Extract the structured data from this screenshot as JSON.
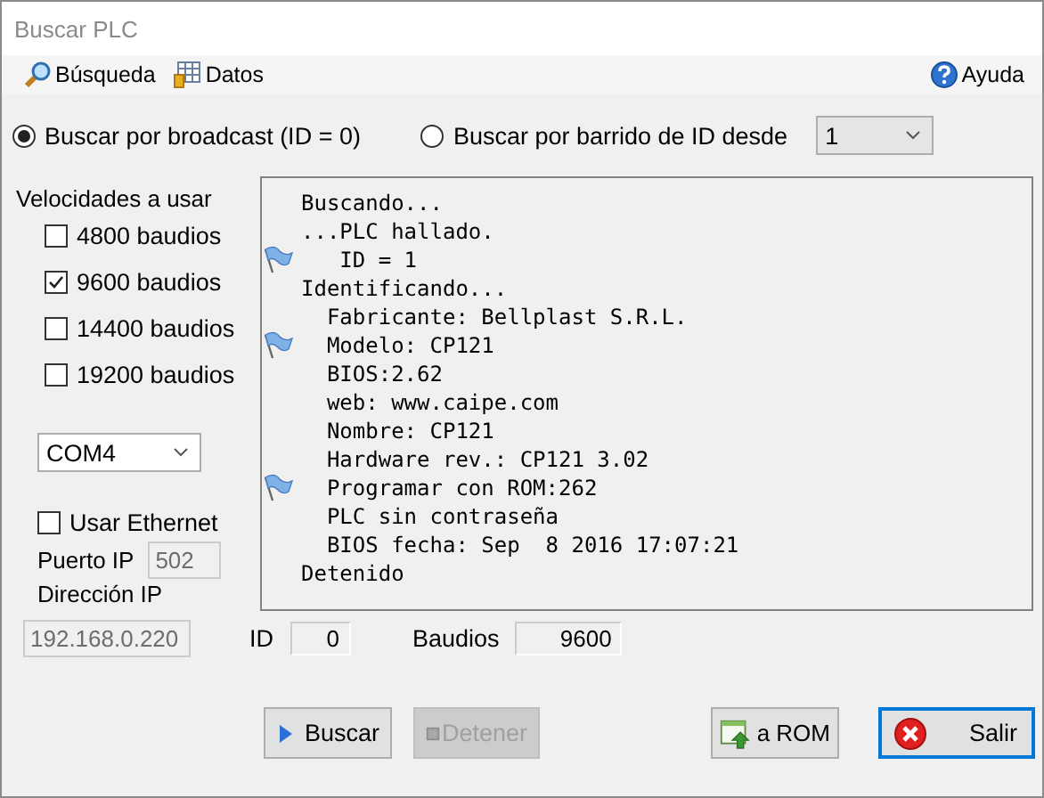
{
  "window": {
    "title": "Buscar PLC"
  },
  "menu": [
    {
      "label": "Búsqueda"
    },
    {
      "label": "Datos"
    }
  ],
  "help": {
    "label": "Ayuda"
  },
  "search_mode": [
    {
      "label": "Buscar por broadcast (ID = 0)",
      "selected": true
    },
    {
      "label": "Buscar por barrido de ID desde",
      "selected": false
    }
  ],
  "start_id": {
    "value": "1"
  },
  "speeds": {
    "title": "Velocidades a usar",
    "items": [
      {
        "label": "4800 baudios",
        "checked": false
      },
      {
        "label": "9600 baudios",
        "checked": true
      },
      {
        "label": "14400 baudios",
        "checked": false
      },
      {
        "label": "19200 baudios",
        "checked": false
      }
    ]
  },
  "port": {
    "value": "COM4"
  },
  "ethernet": {
    "label": "Usar Ethernet",
    "checked": false,
    "port_label": "Puerto IP",
    "port_value": "502",
    "address_label": "Dirección IP",
    "address_value": "192.168.0.220"
  },
  "log": [
    {
      "text": "Buscando...",
      "flag": false
    },
    {
      "text": "...PLC hallado.",
      "flag": false
    },
    {
      "text": "   ID = 1",
      "flag": true
    },
    {
      "text": "Identificando...",
      "flag": false
    },
    {
      "text": "  Fabricante: Bellplast S.R.L.",
      "flag": false
    },
    {
      "text": "  Modelo: CP121",
      "flag": true
    },
    {
      "text": "  BIOS:2.62",
      "flag": false
    },
    {
      "text": "  web: www.caipe.com",
      "flag": false
    },
    {
      "text": "  Nombre: CP121",
      "flag": false
    },
    {
      "text": "  Hardware rev.: CP121 3.02",
      "flag": false
    },
    {
      "text": "  Programar con ROM:262",
      "flag": true
    },
    {
      "text": "  PLC sin contraseña",
      "flag": false
    },
    {
      "text": "  BIOS fecha: Sep  8 2016 17:07:21",
      "flag": false
    },
    {
      "text": "Detenido",
      "flag": false
    }
  ],
  "readouts": [
    {
      "label": "ID",
      "value": "0",
      "kind": "short"
    },
    {
      "label": "Baudios",
      "value": "9600",
      "kind": "long"
    }
  ],
  "buttons": [
    {
      "label": "Buscar",
      "disabled": false,
      "default": false
    },
    {
      "label": "Detener",
      "disabled": true,
      "default": false
    },
    {
      "label": "a ROM",
      "disabled": false,
      "default": false
    },
    {
      "label": "Salir",
      "disabled": false,
      "default": true
    }
  ]
}
